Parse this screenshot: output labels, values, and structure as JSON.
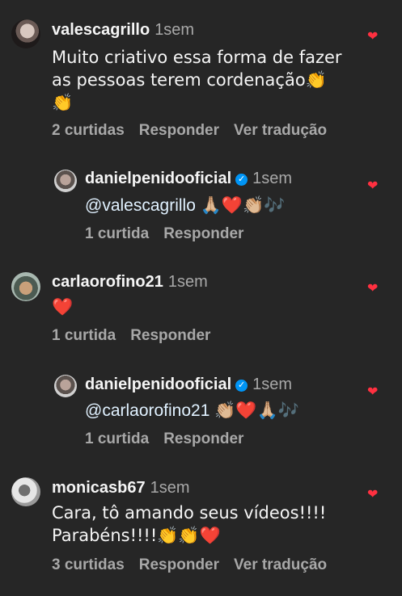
{
  "comments": [
    {
      "username": "valescagrillo",
      "time": "1sem",
      "text_line1": "Muito criativo essa forma de fazer",
      "text_line2": "as pessoas terem cordenação👏",
      "text_line3": "👏",
      "likes": "2 curtidas",
      "reply": "Responder",
      "translate": "Ver tradução"
    },
    {
      "username": "danielpenidooficial",
      "time": "1sem",
      "mention": "@valescagrillo",
      "emojis": "🙏🏼❤️👏🏼🎶",
      "likes": "1 curtida",
      "reply": "Responder"
    },
    {
      "username": "carlaorofino21",
      "time": "1sem",
      "text": "❤️",
      "likes": "1 curtida",
      "reply": "Responder"
    },
    {
      "username": "danielpenidooficial",
      "time": "1sem",
      "mention": "@carlaorofino21",
      "emojis": "👏🏼❤️🙏🏼🎶",
      "likes": "1 curtida",
      "reply": "Responder"
    },
    {
      "username": "monicasb67",
      "time": "1sem",
      "text_line1": "Cara, tô amando seus vídeos!!!!",
      "text_line2": "Parabéns!!!!👏👏❤️",
      "likes": "3 curtidas",
      "reply": "Responder",
      "translate": "Ver tradução"
    }
  ],
  "icons": {
    "heart": "heart-filled-icon",
    "verified": "verified-badge-icon"
  },
  "colors": {
    "background": "#262626",
    "heart": "#ff3040",
    "verified": "#0095f6",
    "secondary": "#a8a8a8"
  }
}
